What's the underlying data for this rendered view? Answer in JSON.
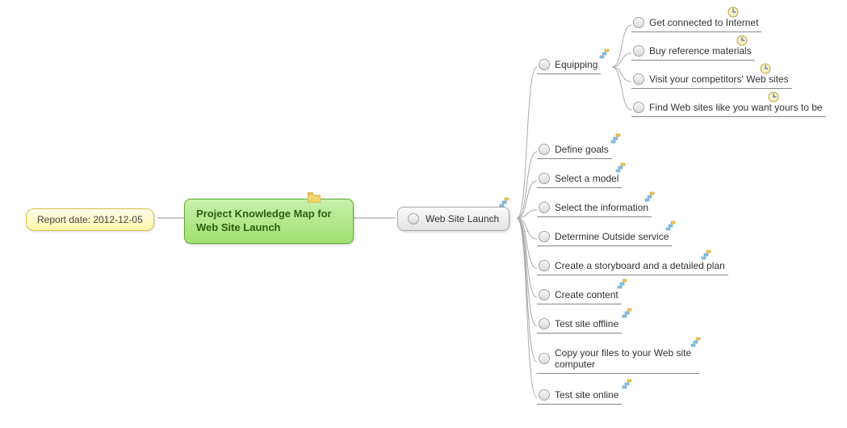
{
  "report_date": "Report date: 2012-12-05",
  "root_title": "Project Knowledge Map for  Web Site Launch",
  "central": "Web Site Launch",
  "equipping": {
    "label": "Equipping",
    "children": [
      "Get connected to Internet",
      "Buy reference materials",
      "Visit your competitors' Web sites",
      "Find Web sites like you want yours to be"
    ]
  },
  "tasks": [
    "Define goals",
    "Select a model",
    "Select the information",
    "Determine Outside service",
    "Create a storyboard and a detailed plan",
    "Create content",
    "Test site offline",
    "Copy your files to your Web site computer",
    "Test site online"
  ]
}
